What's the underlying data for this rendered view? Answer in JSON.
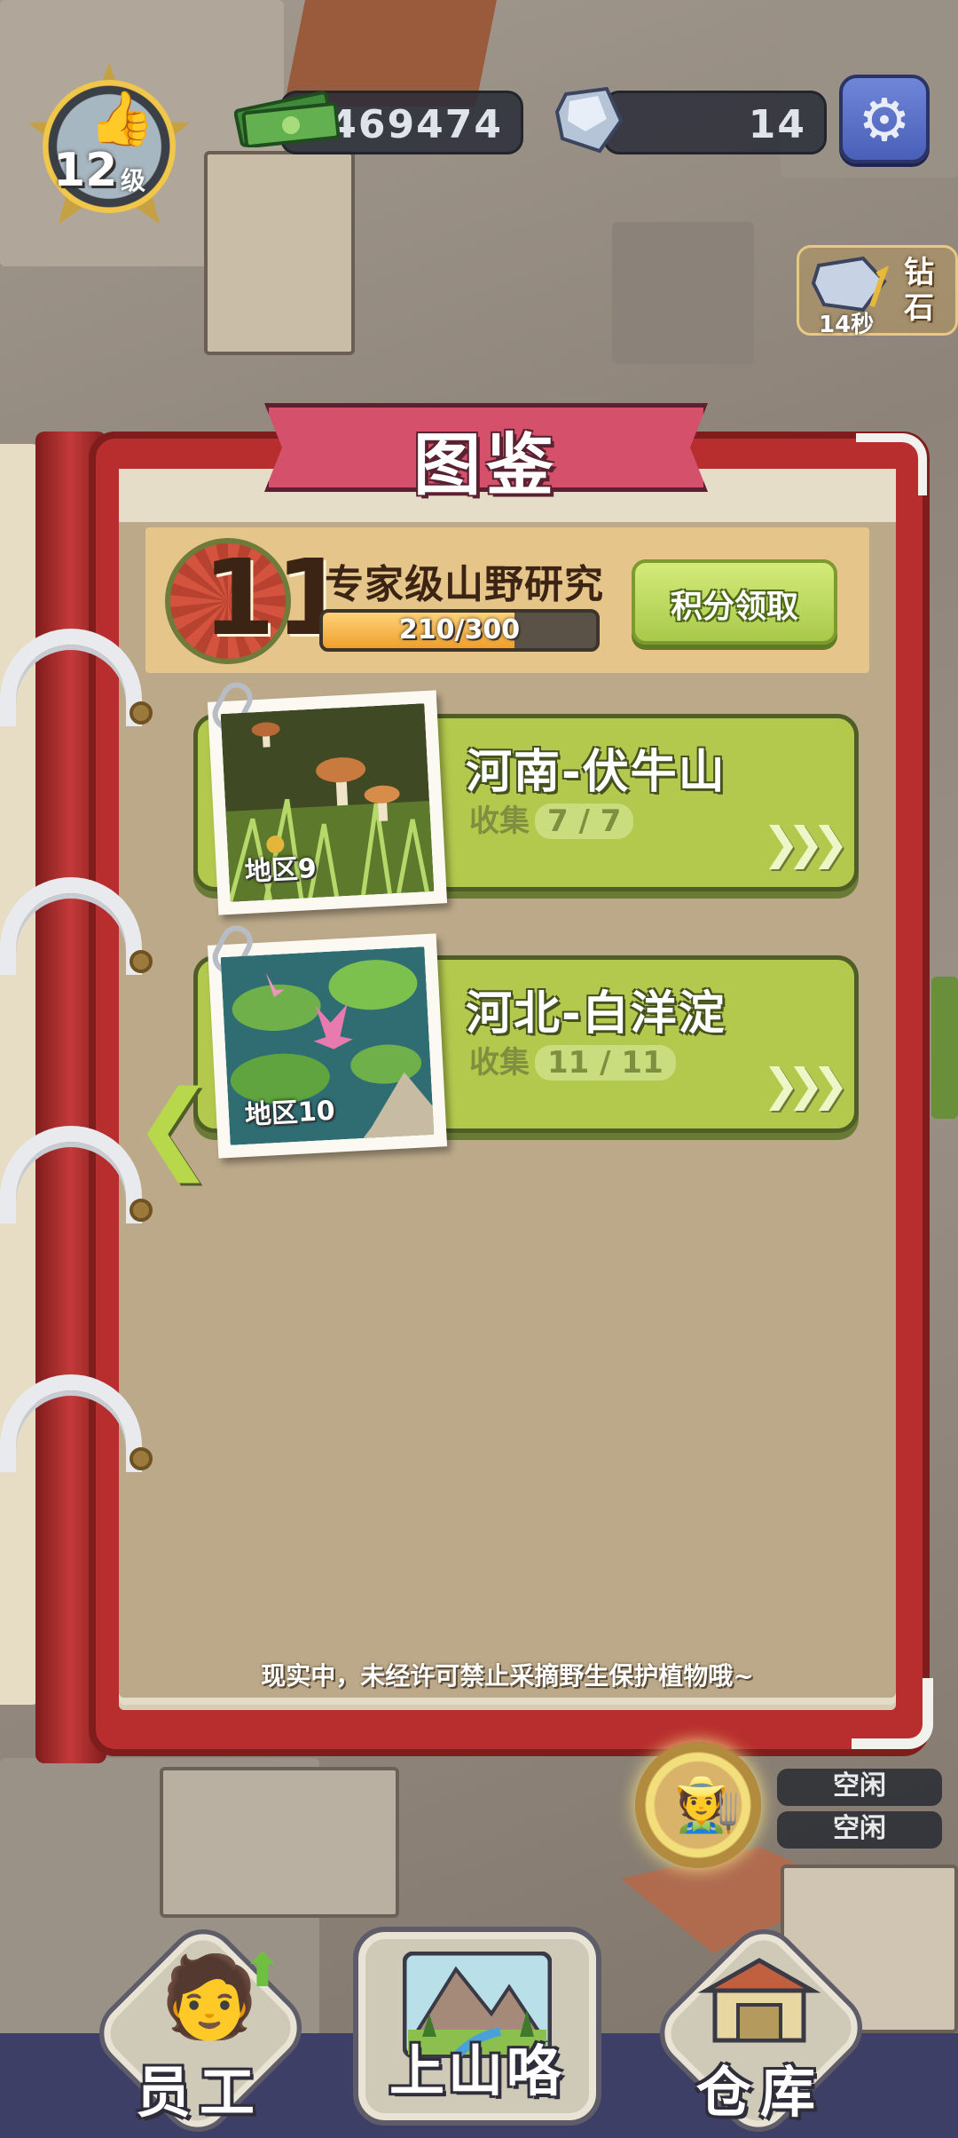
{
  "hud": {
    "level_number": "12",
    "level_unit": "级",
    "cash": "469474",
    "gems": "14",
    "gem_offer_timer": "14秒",
    "gem_offer_label": "钻石"
  },
  "book": {
    "title": "图鉴",
    "rank": {
      "level": "11",
      "title": "专家级山野研究",
      "progress_text": "210/300",
      "progress_fraction": 0.7,
      "claim_button": "积分领取"
    },
    "regions": [
      {
        "name": "河南-伏牛山",
        "collect_label": "收集",
        "collect_value": "7 / 7",
        "area_label": "地区9"
      },
      {
        "name": "河北-白洋淀",
        "collect_label": "收集",
        "collect_value": "11 / 11",
        "area_label": "地区10"
      }
    ],
    "footer_note": "现实中，未经许可禁止采摘野生保护植物哦~"
  },
  "side_status": [
    "空闲",
    "空闲"
  ],
  "nav": {
    "staff": "员工",
    "mountain": "上山咯",
    "warehouse": "仓库"
  },
  "colors": {
    "book_red": "#b82d2d",
    "card_green": "#b3c94d",
    "ribbon_pink": "#d4506b",
    "gear_blue": "#5a70c8"
  }
}
